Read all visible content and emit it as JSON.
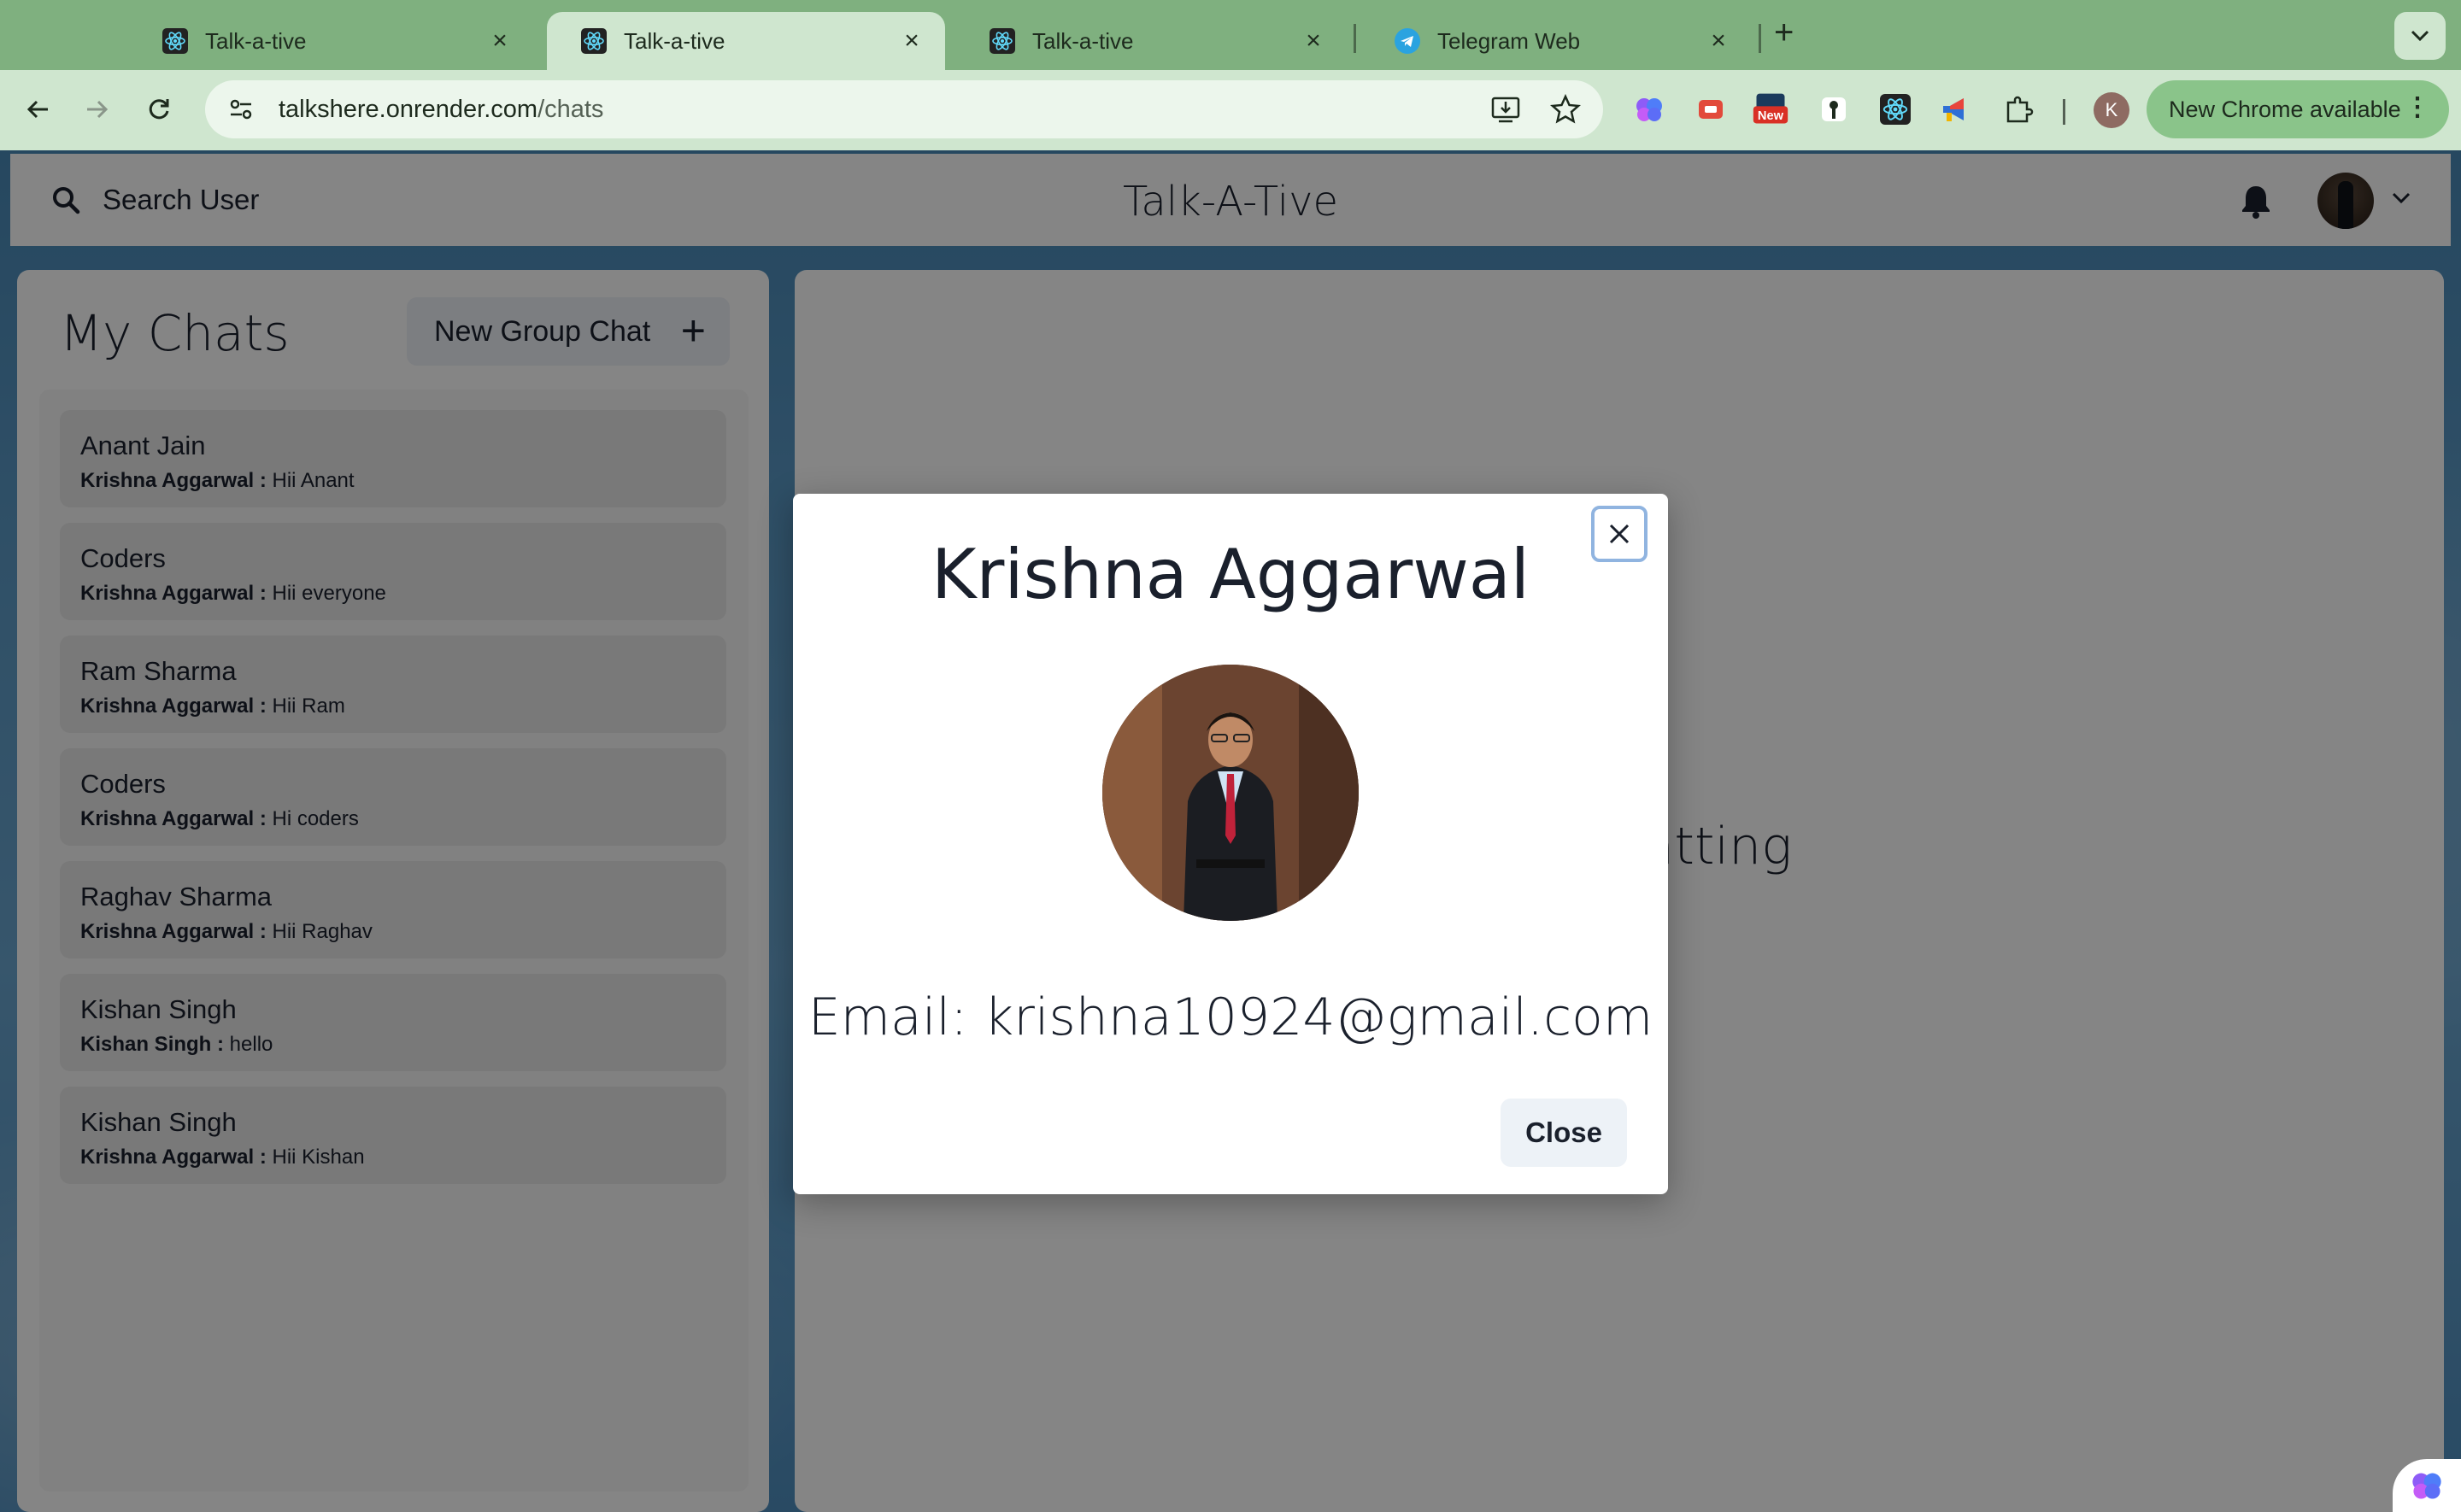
{
  "browser": {
    "tabs": [
      {
        "title": "Talk-a-tive",
        "active": false
      },
      {
        "title": "Talk-a-tive",
        "active": true
      },
      {
        "title": "Talk-a-tive",
        "active": false
      },
      {
        "title": "Telegram Web",
        "active": false
      }
    ],
    "url_host": "talkshere.onrender.com",
    "url_path": "/chats",
    "profile_initial": "K",
    "update_label": "New Chrome available",
    "extension_badge": "New"
  },
  "header": {
    "search_label": "Search User",
    "app_title": "Talk-A-Tive"
  },
  "sidebar": {
    "title": "My Chats",
    "new_group_label": "New Group Chat",
    "chats": [
      {
        "name": "Anant Jain",
        "sender": "Krishna Aggarwal :",
        "message": "Hii Anant"
      },
      {
        "name": "Coders",
        "sender": "Krishna Aggarwal :",
        "message": "Hii everyone"
      },
      {
        "name": "Ram Sharma",
        "sender": "Krishna Aggarwal :",
        "message": "Hii Ram"
      },
      {
        "name": "Coders",
        "sender": "Krishna Aggarwal :",
        "message": "Hi coders"
      },
      {
        "name": "Raghav Sharma",
        "sender": "Krishna Aggarwal :",
        "message": "Hii Raghav"
      },
      {
        "name": "Kishan Singh",
        "sender": "Kishan Singh :",
        "message": "hello"
      },
      {
        "name": "Kishan Singh",
        "sender": "Krishna Aggarwal :",
        "message": "Hii Kishan"
      }
    ]
  },
  "chatbox": {
    "placeholder": "start chatting"
  },
  "modal": {
    "title": "Krishna Aggarwal",
    "email": "Email: krishna10924@gmail.com",
    "close_label": "Close"
  },
  "colors": {
    "chrome_tabbar": "#7fb07f",
    "chrome_toolbar": "#cfe6cf",
    "panel_bg": "#ffffff",
    "chat_item_bg": "#e8e8e8",
    "button_bg": "#edf2f7",
    "focus_ring": "#90b4e0"
  }
}
